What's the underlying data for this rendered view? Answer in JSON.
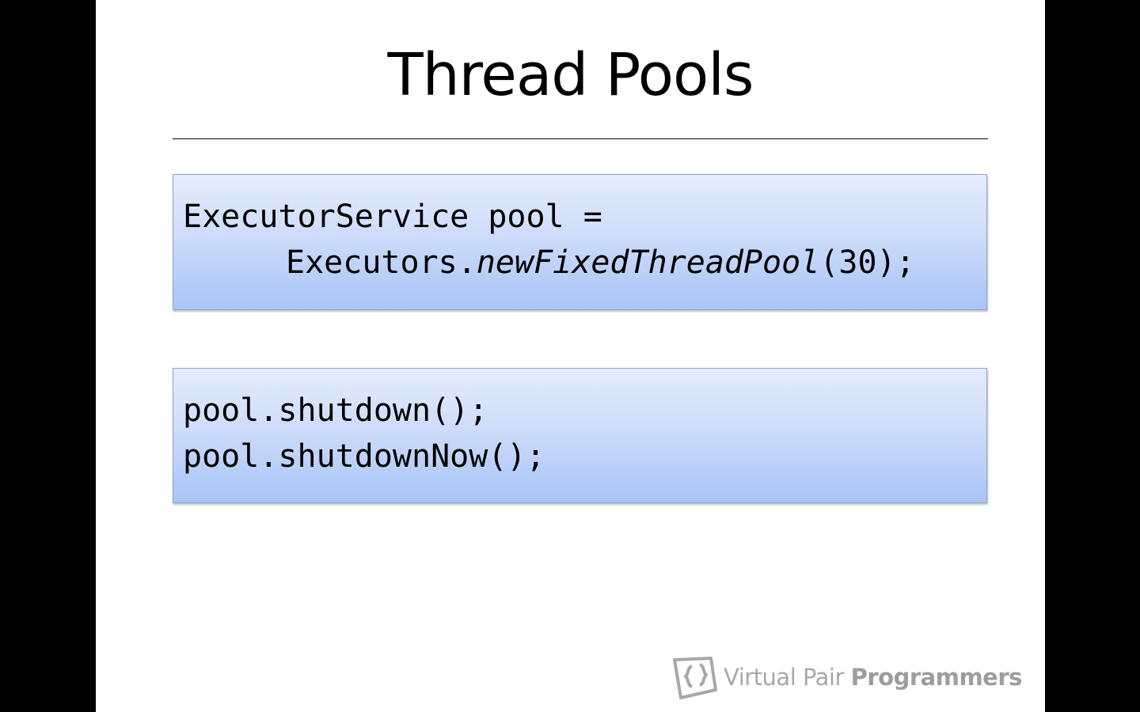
{
  "slide": {
    "title": "Thread Pools",
    "code_block_1": {
      "line1": "ExecutorService pool =",
      "line2_prefix": "Executors.",
      "line2_method": "newFixedThreadPool",
      "line2_suffix": "(30);"
    },
    "code_block_2": {
      "line1": "pool.shutdown();",
      "line2": "pool.shutdownNow();"
    }
  },
  "branding": {
    "logo_icon": "bracketed-pages-icon",
    "name_light": "Virtual Pair ",
    "name_bold": "Programmers",
    "color": "#a8a8a8"
  },
  "colors": {
    "code_box_top": "#e6edfb",
    "code_box_bottom": "#a9c4f6",
    "code_box_border": "#8ea6c9"
  }
}
